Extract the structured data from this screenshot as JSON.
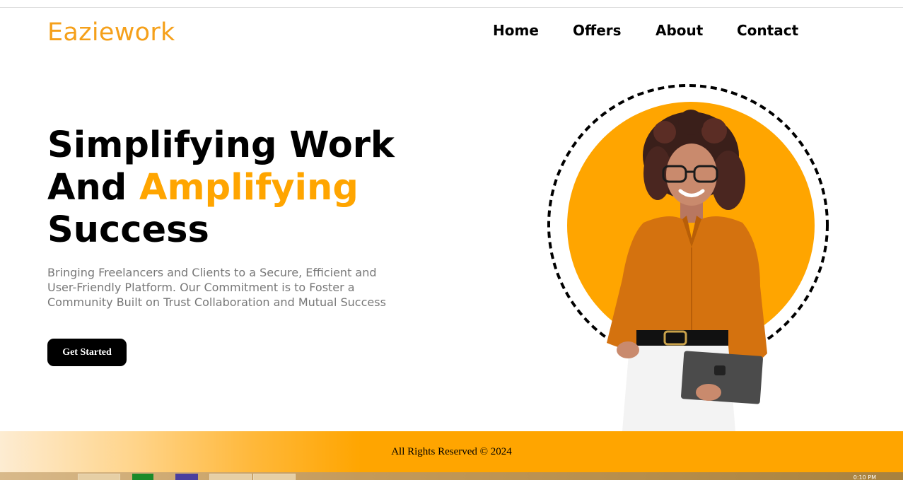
{
  "header": {
    "brand": "Eaziework",
    "nav": [
      {
        "label": "Home"
      },
      {
        "label": "Offers"
      },
      {
        "label": "About"
      },
      {
        "label": "Contact"
      }
    ]
  },
  "hero": {
    "title_line1": "Simplifying Work",
    "title_line2_prefix": "And ",
    "title_line2_accent": "Amplifying",
    "title_line3": "Success",
    "description": "Bringing Freelancers and Clients to a Secure, Efficient and User-Friendly Platform. Our Commitment is to Foster a Community Built on Trust Collaboration and Mutual Success",
    "cta_label": "Get Started",
    "image_icon": "woman-with-tablet-illustration"
  },
  "footer": {
    "text": "All Rights Reserved © 2024"
  },
  "taskbar": {
    "clock": "0:10 PM"
  },
  "colors": {
    "accent": "#ffa500",
    "brand": "#f5a01a",
    "text_dark": "#000000",
    "text_muted": "#777777"
  }
}
